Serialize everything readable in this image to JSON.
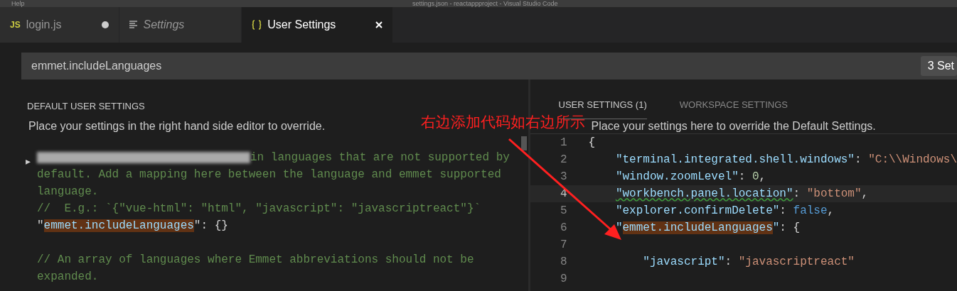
{
  "title_bar": {
    "menu": [
      "Help"
    ],
    "title": "settings.json - reactappproject - Visual Studio Code"
  },
  "tabs": [
    {
      "icon_text": "JS",
      "label": "login.js",
      "italic": false,
      "selected": false,
      "dirty": true
    },
    {
      "label": "Settings",
      "italic": true,
      "selected": false,
      "dirty": false
    },
    {
      "label": "User Settings",
      "italic": false,
      "selected": true,
      "dirty": false
    }
  ],
  "search": {
    "value": "emmet.includeLanguages",
    "count": "3 Set"
  },
  "left_pane": {
    "header": "DEFAULT USER SETTINGS",
    "description": "Place your settings in the right hand side editor to override.",
    "fold_marker": "▸",
    "blocks": [
      [
        {
          "tokens": [
            {
              "kind": "redacted"
            },
            {
              "kind": "comment",
              "text": "in languages that are not supported by"
            }
          ]
        },
        {
          "tokens": [
            {
              "kind": "comment",
              "text": "default. Add a mapping here between the language and emmet supported"
            }
          ]
        },
        {
          "tokens": [
            {
              "kind": "comment",
              "text": "language."
            }
          ]
        },
        {
          "tokens": [
            {
              "kind": "comment",
              "text": "//  E.g.: `{\"vue-html\": \"html\", \"javascript\": \"javascriptreact\"}`"
            }
          ]
        },
        {
          "tokens": [
            {
              "kind": "punct",
              "text": "\""
            },
            {
              "kind": "match",
              "text": "emmet.includeLanguages"
            },
            {
              "kind": "punct",
              "text": "\": {}"
            }
          ]
        }
      ],
      [
        {
          "tokens": [
            {
              "kind": "comment",
              "text": "// An array of languages where Emmet abbreviations should not be"
            }
          ]
        },
        {
          "tokens": [
            {
              "kind": "comment",
              "text": "expanded."
            }
          ]
        }
      ]
    ]
  },
  "right_pane": {
    "tabs": [
      {
        "label": "USER SETTINGS (1)",
        "selected": true
      },
      {
        "label": "WORKSPACE SETTINGS",
        "selected": false
      }
    ],
    "description": "Place your settings here to override the Default Settings.",
    "lines": [
      {
        "number": "1",
        "current": false,
        "tokens": [
          {
            "kind": "punct",
            "text": "{"
          }
        ]
      },
      {
        "number": "2",
        "current": false,
        "tokens": [
          {
            "kind": "key",
            "text": "\"terminal.integrated.shell.windows\""
          },
          {
            "kind": "punct",
            "text": ": "
          },
          {
            "kind": "string",
            "text": "\"C:\\\\Windows\\"
          }
        ]
      },
      {
        "number": "3",
        "current": false,
        "tokens": [
          {
            "kind": "key",
            "text": "\"window.zoomLevel\""
          },
          {
            "kind": "punct",
            "text": ": "
          },
          {
            "kind": "number",
            "text": "0"
          },
          {
            "kind": "punct",
            "text": ","
          }
        ]
      },
      {
        "number": "4",
        "current": true,
        "tokens": [
          {
            "kind": "squiggle",
            "text": "\"workbench.panel.location\""
          },
          {
            "kind": "punct",
            "text": ": "
          },
          {
            "kind": "string",
            "text": "\"bottom\""
          },
          {
            "kind": "punct",
            "text": ","
          }
        ]
      },
      {
        "number": "5",
        "current": false,
        "tokens": [
          {
            "kind": "key",
            "text": "\"explorer.confirmDelete\""
          },
          {
            "kind": "punct",
            "text": ": "
          },
          {
            "kind": "keyword",
            "text": "false"
          },
          {
            "kind": "punct",
            "text": ","
          }
        ]
      },
      {
        "number": "6",
        "current": false,
        "tokens": [
          {
            "kind": "key",
            "text": "\""
          },
          {
            "kind": "match",
            "text": "emmet.includeLanguages"
          },
          {
            "kind": "key",
            "text": "\""
          },
          {
            "kind": "punct",
            "text": ": {"
          }
        ]
      },
      {
        "number": "7",
        "current": false
      },
      {
        "number": "8",
        "current": false,
        "tokens": [
          {
            "kind": "key",
            "text": "\"javascript\""
          },
          {
            "kind": "punct",
            "text": ": "
          },
          {
            "kind": "string",
            "text": "\"javascriptreact\""
          }
        ]
      },
      {
        "number": "9",
        "current": false
      }
    ]
  },
  "annotation": {
    "text": "右边添加代码如右边所示"
  }
}
